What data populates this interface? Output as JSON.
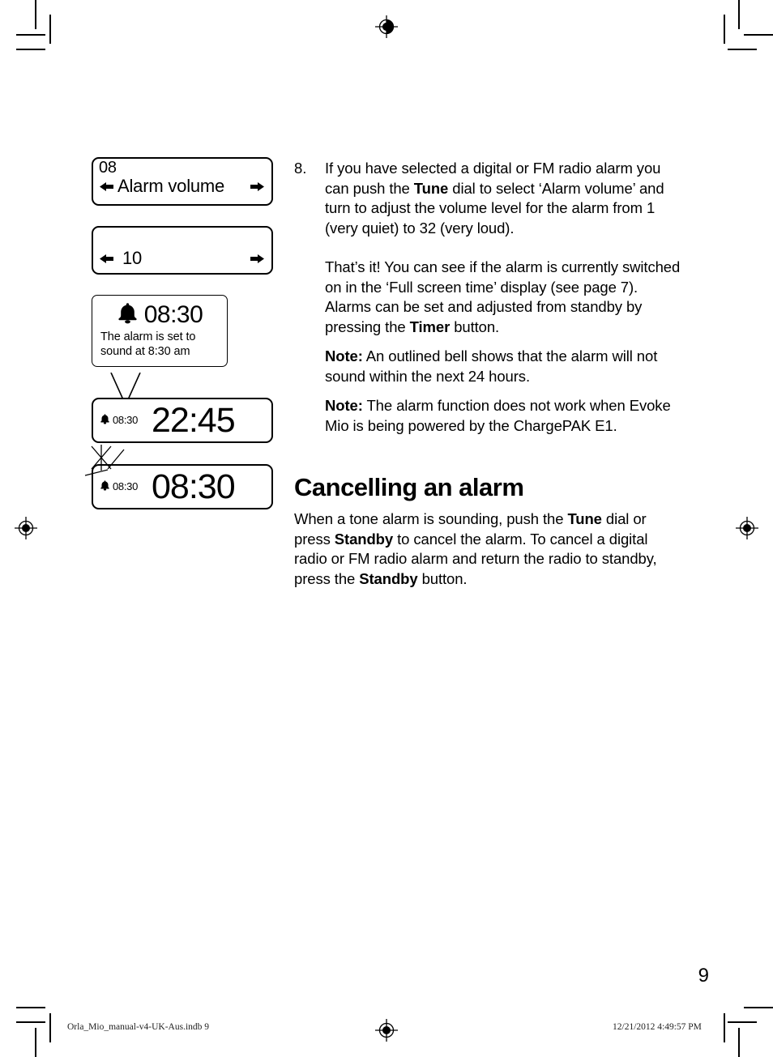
{
  "document": {
    "page_number": "9",
    "footer_left": "Orla_Mio_manual-v4-UK-Aus.indb   9",
    "footer_right": "12/21/2012   4:49:57 PM"
  },
  "figures": {
    "menu_display": {
      "index": "08",
      "label": "Alarm volume",
      "left_arrow": "left-arrow-icon",
      "right_arrow": "right-arrow-icon"
    },
    "value_display": {
      "value": "10",
      "left_arrow": "left-arrow-icon",
      "right_arrow": "right-arrow-icon"
    },
    "callout": {
      "bell_icon": "bell-filled-icon",
      "time": "08:30",
      "caption_line1": "The alarm is set to",
      "caption_line2": "sound at 8:30 am"
    },
    "time_display_1": {
      "bell_icon": "bell-filled-icon",
      "alarm_time": "08:30",
      "clock_time": "22:45"
    },
    "time_display_2": {
      "bell_icon": "bell-outlined-icon",
      "alarm_time": "08:30",
      "clock_time": "08:30"
    }
  },
  "content": {
    "step_8": {
      "number": "8.",
      "para1_a": "If you have selected a digital or FM radio alarm you can push the ",
      "para1_b": "Tune",
      "para1_c": " dial to select ‘Alarm volume’ and turn to adjust the volume level for the alarm from 1 (very quiet) to 32 (very loud).",
      "para2_a": "That’s it! You can see if the alarm is currently switched on in the ‘Full screen time’ display (see page 7). Alarms can be set and adjusted from standby by pressing the ",
      "para2_b": "Timer",
      "para2_c": " button.",
      "note1_label": "Note:",
      "note1_text": " An outlined bell shows that the alarm will not sound within the next 24 hours.",
      "note2_label": "Note:",
      "note2_text": " The alarm function does not work when Evoke Mio is being powered by the ChargePAK E1."
    },
    "cancelling_section": {
      "heading": "Cancelling an alarm",
      "para_a": "When a tone alarm is sounding, push the ",
      "para_b": "Tune",
      "para_c": " dial or press ",
      "para_d": "Standby",
      "para_e": " to cancel the alarm. To cancel a digital radio or FM radio alarm and return the radio to standby, press the ",
      "para_f": "Standby",
      "para_g": " button."
    }
  }
}
